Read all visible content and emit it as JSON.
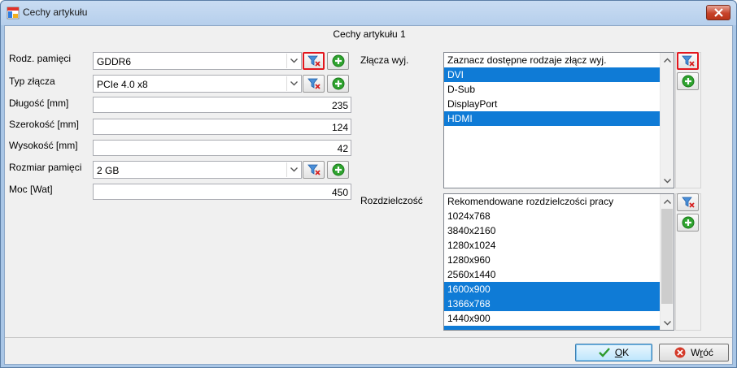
{
  "window": {
    "title": "Cechy artykułu",
    "close_icon": "close-icon"
  },
  "header": {
    "title": "Cechy artykułu 1"
  },
  "fields": {
    "rodz_pamieci": {
      "label": "Rodz. pamięci",
      "value": "GDDR6"
    },
    "typ_zlacza": {
      "label": "Typ złącza",
      "value": "PCIe 4.0 x8"
    },
    "dlugosc": {
      "label": "Długość [mm]",
      "value": "235"
    },
    "szerokosc": {
      "label": "Szerokość [mm]",
      "value": "124"
    },
    "wysokosc": {
      "label": "Wysokość [mm]",
      "value": "42"
    },
    "rozmiar_pamieci": {
      "label": "Rozmiar pamięci",
      "value": "2 GB"
    },
    "moc": {
      "label": "Moc [Wat]",
      "value": "450"
    }
  },
  "zlacza": {
    "label": "Złącza wyj.",
    "items": [
      {
        "text": "Zaznacz dostępne rodzaje złącz wyj.",
        "selected": false
      },
      {
        "text": "DVI",
        "selected": true
      },
      {
        "text": "D-Sub",
        "selected": false
      },
      {
        "text": "DisplayPort",
        "selected": false
      },
      {
        "text": "HDMI",
        "selected": true
      }
    ]
  },
  "rozdzielczosc": {
    "label": "Rozdzielczość",
    "items": [
      {
        "text": "Rekomendowane rozdzielczości pracy",
        "selected": false
      },
      {
        "text": "1024x768",
        "selected": false
      },
      {
        "text": "3840x2160",
        "selected": false
      },
      {
        "text": "1280x1024",
        "selected": false
      },
      {
        "text": "1280x960",
        "selected": false
      },
      {
        "text": "2560x1440",
        "selected": false
      },
      {
        "text": "1600x900",
        "selected": true
      },
      {
        "text": "1366x768",
        "selected": true
      },
      {
        "text": "1440x900",
        "selected": false
      },
      {
        "text": "",
        "selected": true
      }
    ]
  },
  "buttons": {
    "ok_prefix": "",
    "ok_accel": "O",
    "ok_rest": "K",
    "cancel_prefix": "W",
    "cancel_accel": "r",
    "cancel_rest": "óć"
  },
  "icons": {
    "filter": "filter-icon",
    "add": "add-icon",
    "dropdown": "chevron-down-icon"
  },
  "colors": {
    "selection": "#0f7bd6",
    "filter_highlight": "#e2161d",
    "add_green": "#2fa32f"
  }
}
